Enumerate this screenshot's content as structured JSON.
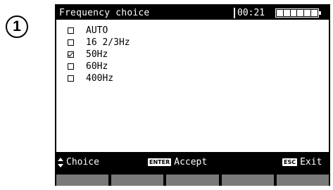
{
  "step": {
    "number": "1"
  },
  "header": {
    "title": "Frequency choice",
    "time": "00:21",
    "battery_cells": 6
  },
  "options": [
    {
      "label": "AUTO",
      "checked": false
    },
    {
      "label": "16 2/3Hz",
      "checked": false
    },
    {
      "label": "50Hz",
      "checked": true
    },
    {
      "label": "60Hz",
      "checked": false
    },
    {
      "label": "400Hz",
      "checked": false
    }
  ],
  "footer": {
    "choice_label": "Choice",
    "accept_key": "ENTER",
    "accept_label": "Accept",
    "exit_key": "ESC",
    "exit_label": "Exit"
  },
  "softkeys": [
    "",
    "",
    "",
    "",
    ""
  ]
}
